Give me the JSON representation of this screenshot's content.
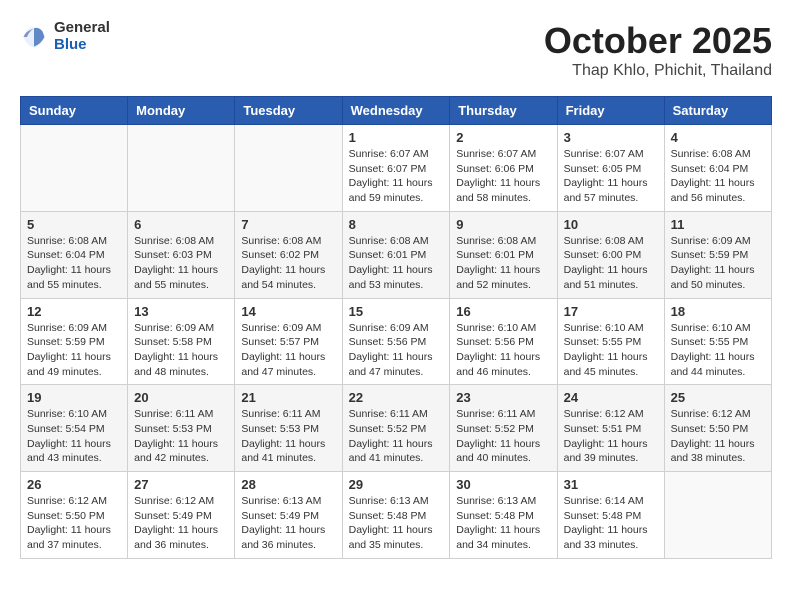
{
  "header": {
    "logo_general": "General",
    "logo_blue": "Blue",
    "month_title": "October 2025",
    "location": "Thap Khlo, Phichit, Thailand"
  },
  "days_of_week": [
    "Sunday",
    "Monday",
    "Tuesday",
    "Wednesday",
    "Thursday",
    "Friday",
    "Saturday"
  ],
  "weeks": [
    [
      {
        "day": "",
        "text": ""
      },
      {
        "day": "",
        "text": ""
      },
      {
        "day": "",
        "text": ""
      },
      {
        "day": "1",
        "text": "Sunrise: 6:07 AM\nSunset: 6:07 PM\nDaylight: 11 hours and 59 minutes."
      },
      {
        "day": "2",
        "text": "Sunrise: 6:07 AM\nSunset: 6:06 PM\nDaylight: 11 hours and 58 minutes."
      },
      {
        "day": "3",
        "text": "Sunrise: 6:07 AM\nSunset: 6:05 PM\nDaylight: 11 hours and 57 minutes."
      },
      {
        "day": "4",
        "text": "Sunrise: 6:08 AM\nSunset: 6:04 PM\nDaylight: 11 hours and 56 minutes."
      }
    ],
    [
      {
        "day": "5",
        "text": "Sunrise: 6:08 AM\nSunset: 6:04 PM\nDaylight: 11 hours and 55 minutes."
      },
      {
        "day": "6",
        "text": "Sunrise: 6:08 AM\nSunset: 6:03 PM\nDaylight: 11 hours and 55 minutes."
      },
      {
        "day": "7",
        "text": "Sunrise: 6:08 AM\nSunset: 6:02 PM\nDaylight: 11 hours and 54 minutes."
      },
      {
        "day": "8",
        "text": "Sunrise: 6:08 AM\nSunset: 6:01 PM\nDaylight: 11 hours and 53 minutes."
      },
      {
        "day": "9",
        "text": "Sunrise: 6:08 AM\nSunset: 6:01 PM\nDaylight: 11 hours and 52 minutes."
      },
      {
        "day": "10",
        "text": "Sunrise: 6:08 AM\nSunset: 6:00 PM\nDaylight: 11 hours and 51 minutes."
      },
      {
        "day": "11",
        "text": "Sunrise: 6:09 AM\nSunset: 5:59 PM\nDaylight: 11 hours and 50 minutes."
      }
    ],
    [
      {
        "day": "12",
        "text": "Sunrise: 6:09 AM\nSunset: 5:59 PM\nDaylight: 11 hours and 49 minutes."
      },
      {
        "day": "13",
        "text": "Sunrise: 6:09 AM\nSunset: 5:58 PM\nDaylight: 11 hours and 48 minutes."
      },
      {
        "day": "14",
        "text": "Sunrise: 6:09 AM\nSunset: 5:57 PM\nDaylight: 11 hours and 47 minutes."
      },
      {
        "day": "15",
        "text": "Sunrise: 6:09 AM\nSunset: 5:56 PM\nDaylight: 11 hours and 47 minutes."
      },
      {
        "day": "16",
        "text": "Sunrise: 6:10 AM\nSunset: 5:56 PM\nDaylight: 11 hours and 46 minutes."
      },
      {
        "day": "17",
        "text": "Sunrise: 6:10 AM\nSunset: 5:55 PM\nDaylight: 11 hours and 45 minutes."
      },
      {
        "day": "18",
        "text": "Sunrise: 6:10 AM\nSunset: 5:55 PM\nDaylight: 11 hours and 44 minutes."
      }
    ],
    [
      {
        "day": "19",
        "text": "Sunrise: 6:10 AM\nSunset: 5:54 PM\nDaylight: 11 hours and 43 minutes."
      },
      {
        "day": "20",
        "text": "Sunrise: 6:11 AM\nSunset: 5:53 PM\nDaylight: 11 hours and 42 minutes."
      },
      {
        "day": "21",
        "text": "Sunrise: 6:11 AM\nSunset: 5:53 PM\nDaylight: 11 hours and 41 minutes."
      },
      {
        "day": "22",
        "text": "Sunrise: 6:11 AM\nSunset: 5:52 PM\nDaylight: 11 hours and 41 minutes."
      },
      {
        "day": "23",
        "text": "Sunrise: 6:11 AM\nSunset: 5:52 PM\nDaylight: 11 hours and 40 minutes."
      },
      {
        "day": "24",
        "text": "Sunrise: 6:12 AM\nSunset: 5:51 PM\nDaylight: 11 hours and 39 minutes."
      },
      {
        "day": "25",
        "text": "Sunrise: 6:12 AM\nSunset: 5:50 PM\nDaylight: 11 hours and 38 minutes."
      }
    ],
    [
      {
        "day": "26",
        "text": "Sunrise: 6:12 AM\nSunset: 5:50 PM\nDaylight: 11 hours and 37 minutes."
      },
      {
        "day": "27",
        "text": "Sunrise: 6:12 AM\nSunset: 5:49 PM\nDaylight: 11 hours and 36 minutes."
      },
      {
        "day": "28",
        "text": "Sunrise: 6:13 AM\nSunset: 5:49 PM\nDaylight: 11 hours and 36 minutes."
      },
      {
        "day": "29",
        "text": "Sunrise: 6:13 AM\nSunset: 5:48 PM\nDaylight: 11 hours and 35 minutes."
      },
      {
        "day": "30",
        "text": "Sunrise: 6:13 AM\nSunset: 5:48 PM\nDaylight: 11 hours and 34 minutes."
      },
      {
        "day": "31",
        "text": "Sunrise: 6:14 AM\nSunset: 5:48 PM\nDaylight: 11 hours and 33 minutes."
      },
      {
        "day": "",
        "text": ""
      }
    ]
  ]
}
